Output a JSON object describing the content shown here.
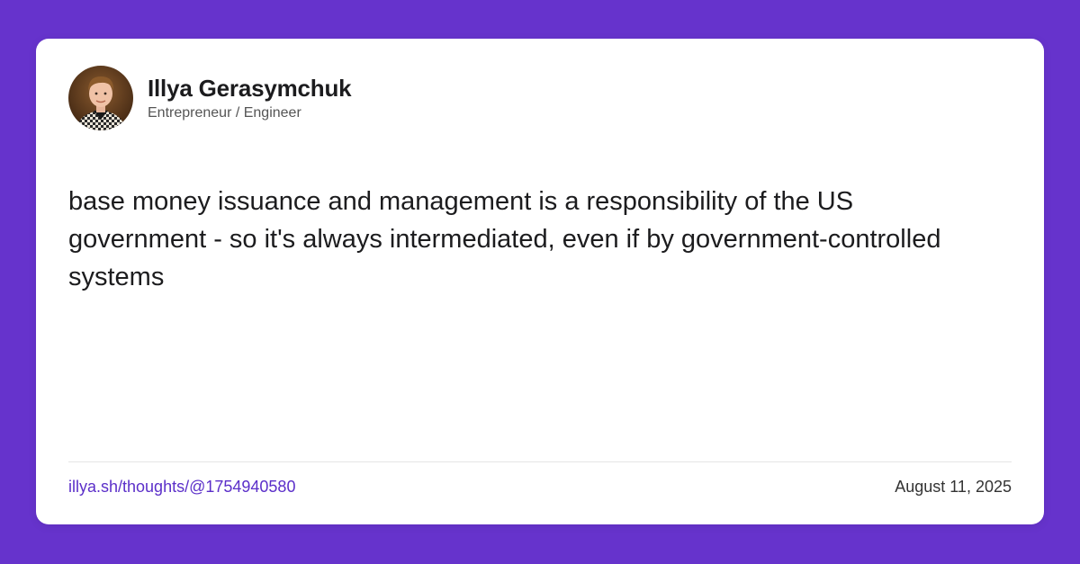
{
  "theme": {
    "background": "#6633cc",
    "card": "#ffffff",
    "link_color": "#5b2fc9"
  },
  "author": {
    "name": "Illya Gerasymchuk",
    "role": "Entrepreneur / Engineer",
    "avatar_icon": "profile-photo"
  },
  "post": {
    "text": "base money issuance and management is a responsibility of the US government - so it's always intermediated, even if by government-controlled systems"
  },
  "footer": {
    "link": "illya.sh/thoughts/@1754940580",
    "date": "August 11, 2025"
  }
}
